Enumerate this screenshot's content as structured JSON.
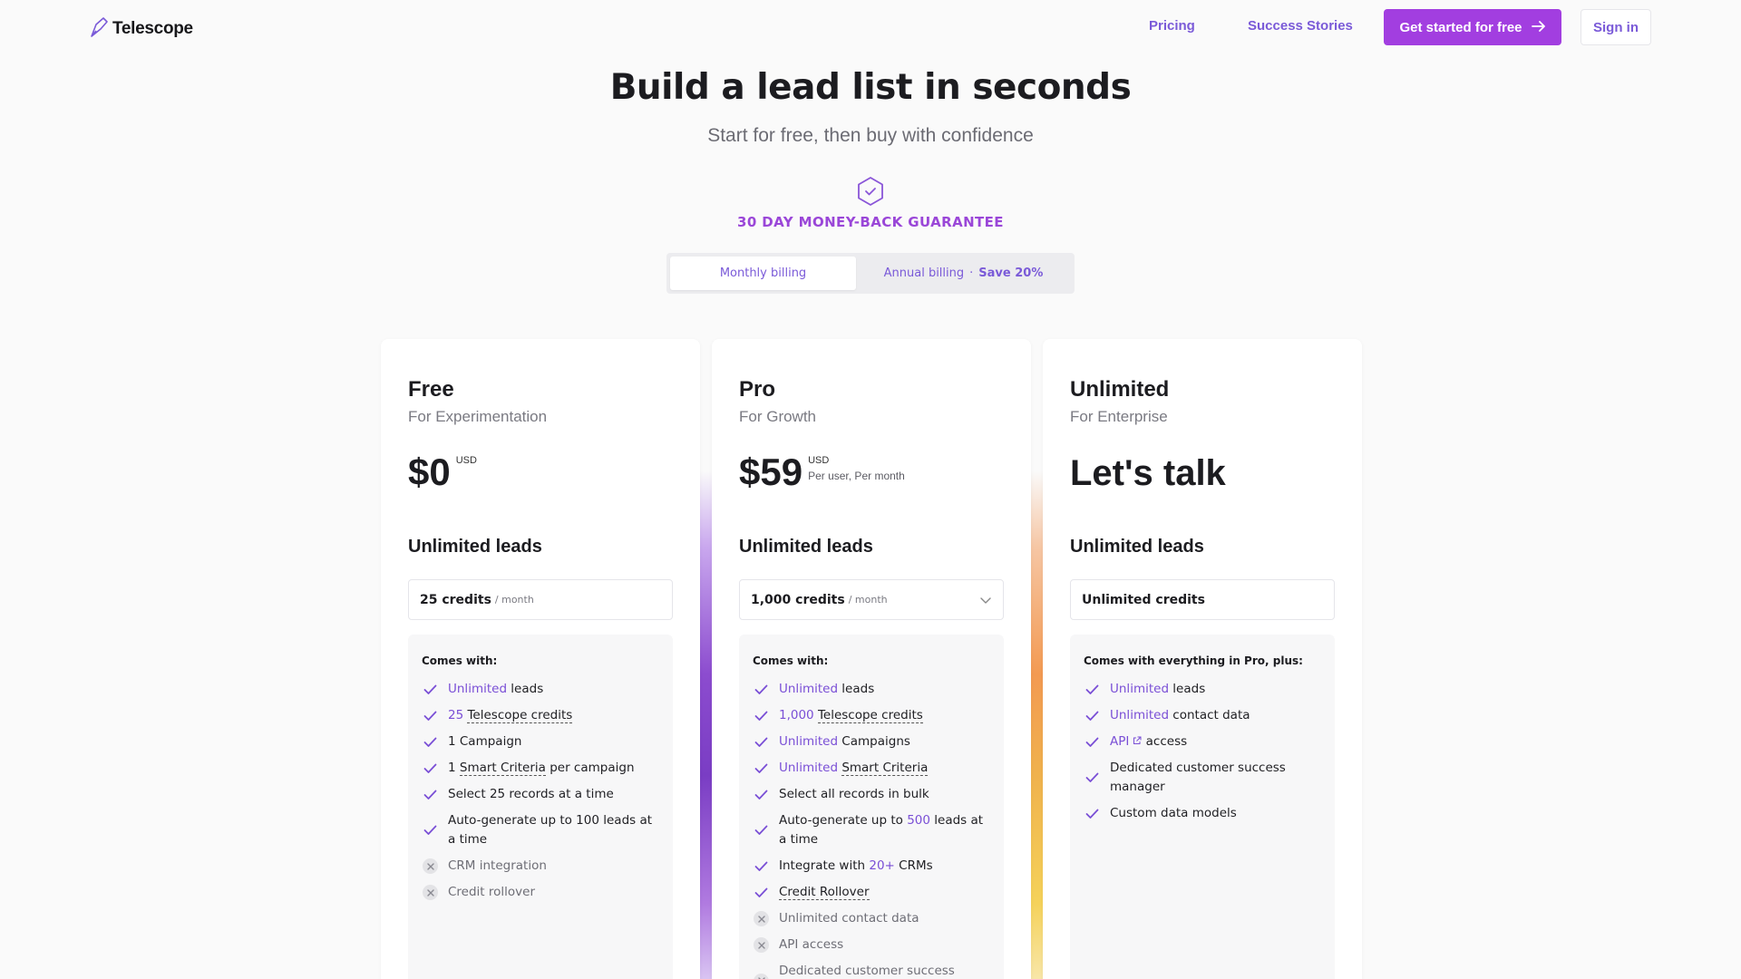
{
  "nav": {
    "logo_text": "Telescope",
    "links": [
      "Pricing",
      "Success Stories"
    ],
    "cta_label": "Get started for free",
    "signin_label": "Sign in"
  },
  "hero": {
    "title": "Build a lead list in seconds",
    "subtitle": "Start for free, then buy with confidence",
    "guarantee": "30 DAY MONEY-BACK GUARANTEE"
  },
  "billing": {
    "monthly": "Monthly billing",
    "annual": "Annual billing",
    "separator": "·",
    "save": "Save 20%"
  },
  "colors": {
    "accent": "#7a5ad8",
    "cta": "#a23ee0",
    "guarantee": "#9a46d8"
  },
  "plans": [
    {
      "name": "Free",
      "tagline": "For Experimentation",
      "price": "$0",
      "currency": "USD",
      "leads_heading": "Unlimited leads",
      "credits_value": "25 credits",
      "credits_unit": "/ month",
      "features_heading": "Comes with:",
      "features": [
        {
          "hl": "Unlimited",
          "text": " leads",
          "included": true
        },
        {
          "hl": "25",
          "ul": "Telescope credits",
          "text": "",
          "included": true
        },
        {
          "text": "1 Campaign",
          "included": true
        },
        {
          "pre": "1 ",
          "ul": "Smart Criteria",
          "text": " per campaign",
          "included": true
        },
        {
          "text": "Select 25 records at a time",
          "included": true
        },
        {
          "text": "Auto-generate up to 100 leads at a time",
          "included": true
        },
        {
          "text": "CRM integration",
          "included": false
        },
        {
          "text": "Credit rollover",
          "included": false
        }
      ]
    },
    {
      "name": "Pro",
      "tagline": "For Growth",
      "price": "$59",
      "currency": "USD",
      "per_user": "Per user, Per month",
      "leads_heading": "Unlimited leads",
      "credits_value": "1,000 credits",
      "credits_unit": "/ month",
      "features_heading": "Comes with:",
      "features": [
        {
          "hl": "Unlimited",
          "text": " leads",
          "included": true
        },
        {
          "hl": "1,000",
          "ul": "Telescope credits",
          "text": "",
          "included": true
        },
        {
          "hl": "Unlimited",
          "text": " Campaigns",
          "included": true
        },
        {
          "hl": "Unlimited",
          "ul": "Smart Criteria",
          "text": "",
          "included": true
        },
        {
          "text": "Select all records in bulk",
          "included": true
        },
        {
          "pre": "Auto-generate up to ",
          "hl": "500",
          "text": " leads at a time",
          "included": true
        },
        {
          "pre": "Integrate with ",
          "hl": "20+",
          "text": " CRMs",
          "included": true
        },
        {
          "ul": "Credit Rollover",
          "text": "",
          "included": true
        },
        {
          "text": "Unlimited contact data",
          "included": false
        },
        {
          "text": "API access",
          "included": false
        },
        {
          "text": "Dedicated customer success manager",
          "included": false
        }
      ]
    },
    {
      "name": "Unlimited",
      "tagline": "For Enterprise",
      "price_text": "Let's talk",
      "leads_heading": "Unlimited leads",
      "credits_value": "Unlimited credits",
      "features_heading": "Comes with everything in Pro, plus:",
      "features": [
        {
          "hl": "Unlimited",
          "text": " leads",
          "included": true
        },
        {
          "hl": "Unlimited",
          "text": " contact data",
          "included": true
        },
        {
          "hl": "API",
          "ext": true,
          "text": " access",
          "included": true
        },
        {
          "text": "Dedicated customer success manager",
          "included": true
        },
        {
          "text": "Custom data models",
          "included": true
        }
      ]
    }
  ]
}
